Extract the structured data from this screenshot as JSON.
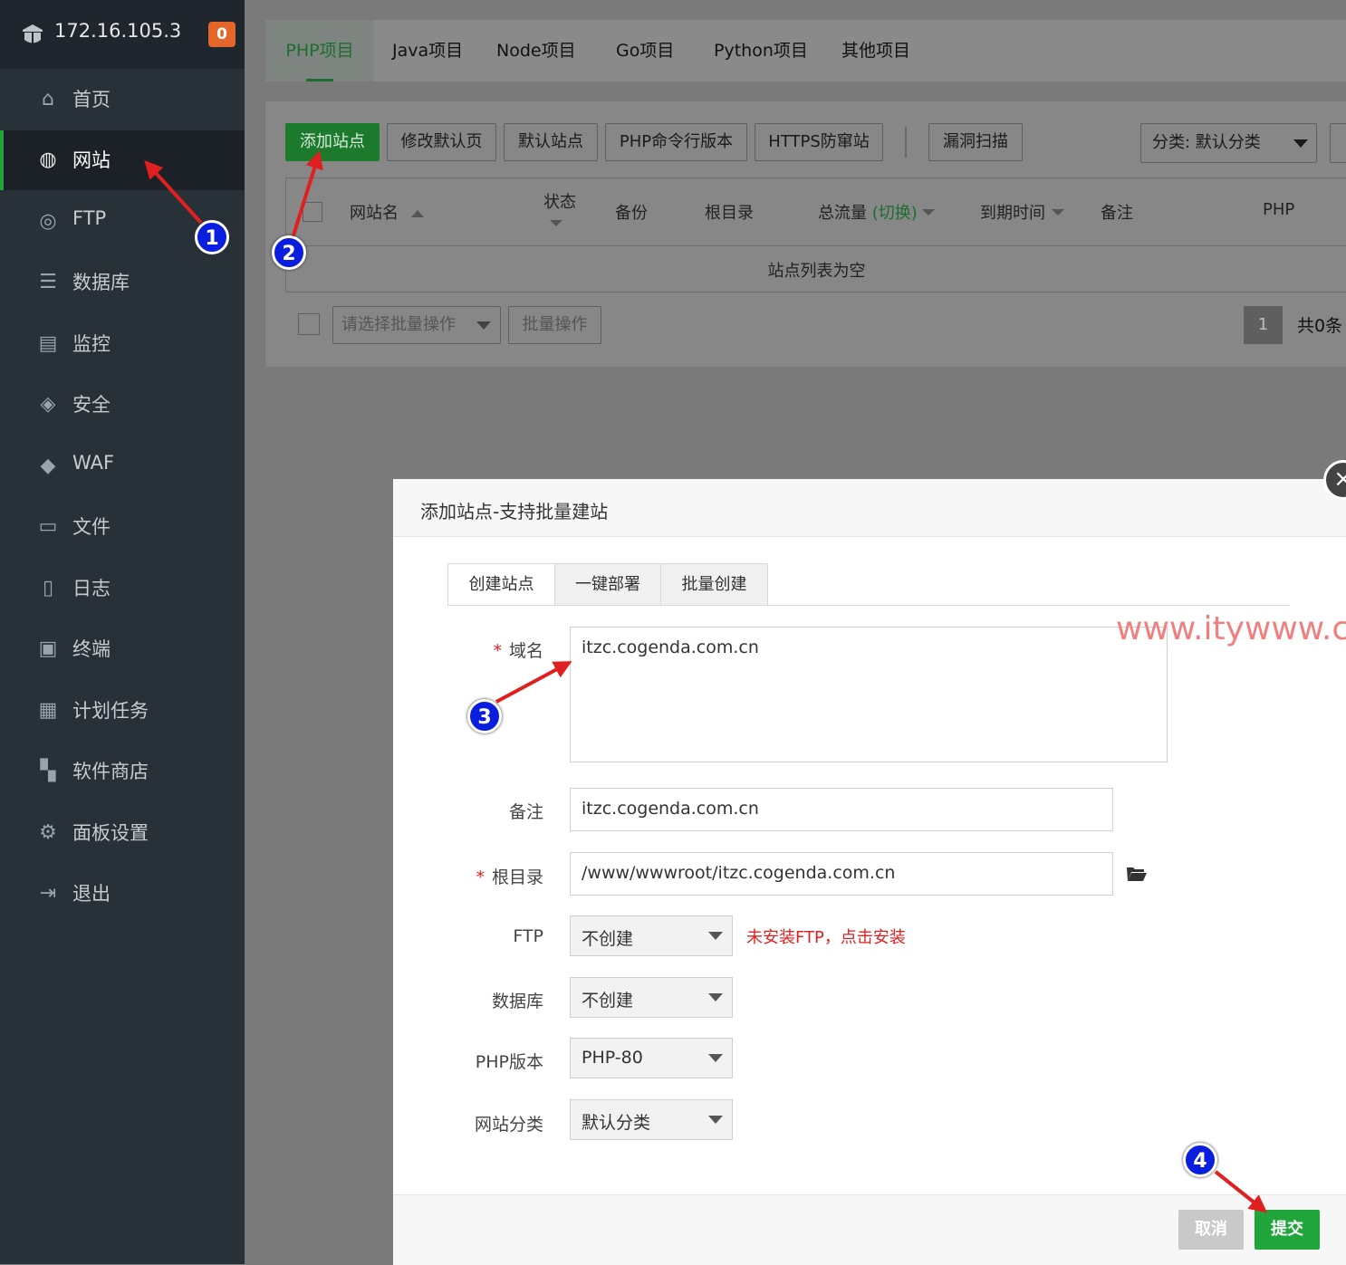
{
  "sidebar": {
    "server_ip": "172.16.105.3",
    "badge_count": "0",
    "items": [
      {
        "label": "首页",
        "icon": "home-icon"
      },
      {
        "label": "网站",
        "icon": "globe-icon",
        "active": true
      },
      {
        "label": "FTP",
        "icon": "ftp-icon"
      },
      {
        "label": "数据库",
        "icon": "database-icon"
      },
      {
        "label": "监控",
        "icon": "monitor-icon"
      },
      {
        "label": "安全",
        "icon": "shield-icon"
      },
      {
        "label": "WAF",
        "icon": "waf-icon"
      },
      {
        "label": "文件",
        "icon": "folder-icon"
      },
      {
        "label": "日志",
        "icon": "log-icon"
      },
      {
        "label": "终端",
        "icon": "terminal-icon"
      },
      {
        "label": "计划任务",
        "icon": "calendar-icon"
      },
      {
        "label": "软件商店",
        "icon": "apps-icon"
      },
      {
        "label": "面板设置",
        "icon": "gear-icon"
      },
      {
        "label": "退出",
        "icon": "logout-icon"
      }
    ]
  },
  "project_tabs": [
    "PHP项目",
    "Java项目",
    "Node项目",
    "Go项目",
    "Python项目",
    "其他项目"
  ],
  "toolbar": {
    "add_site": "添加站点",
    "edit_default_page": "修改默认页",
    "default_site": "默认站点",
    "php_cli_version": "PHP命令行版本",
    "https_guard": "HTTPS防窜站",
    "vuln_scan": "漏洞扫描",
    "category_select": "分类: 默认分类"
  },
  "table": {
    "headers": {
      "site_name": "网站名",
      "status": "状态",
      "backup": "备份",
      "root": "根目录",
      "traffic": "总流量",
      "traffic_switch": "(切换)",
      "expire": "到期时间",
      "remark": "备注",
      "php": "PHP"
    },
    "empty_text": "站点列表为空"
  },
  "batch": {
    "select_placeholder": "请选择批量操作",
    "button": "批量操作"
  },
  "pager": {
    "current_page": "1",
    "total": "共0条"
  },
  "modal": {
    "title": "添加站点-支持批量建站",
    "tabs": [
      "创建站点",
      "一键部署",
      "批量创建"
    ],
    "fields": {
      "domain_label": "域名",
      "domain_value": "itzc.cogenda.com.cn",
      "remark_label": "备注",
      "remark_value": "itzc.cogenda.com.cn",
      "root_label": "根目录",
      "root_value": "/www/wwwroot/itzc.cogenda.com.cn",
      "ftp_label": "FTP",
      "ftp_value": "不创建",
      "ftp_warning": "未安装FTP，点击安装",
      "db_label": "数据库",
      "db_value": "不创建",
      "php_label": "PHP版本",
      "php_value": "PHP-80",
      "category_label": "网站分类",
      "category_value": "默认分类"
    },
    "cancel": "取消",
    "submit": "提交"
  },
  "watermark": "www.itywww.cn",
  "annotations": [
    "1",
    "2",
    "3",
    "4"
  ],
  "colors": {
    "brand_green": "#20a53a",
    "annotation_blue": "#0a1ee0",
    "arrow_red": "#e02020",
    "warning_red": "#e02020"
  }
}
